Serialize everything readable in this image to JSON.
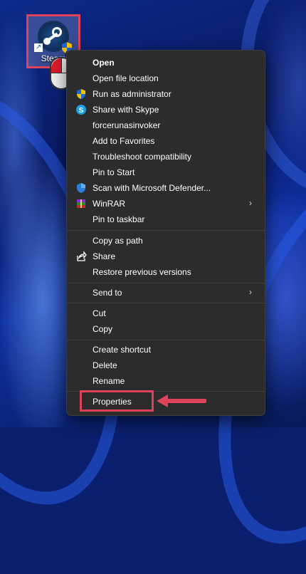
{
  "desktop": {
    "icon_label": "Steam"
  },
  "context_menu": {
    "items": [
      {
        "label": "Open",
        "icon": "none"
      },
      {
        "label": "Open file location",
        "icon": "none"
      },
      {
        "label": "Run as administrator",
        "icon": "uac-shield-icon"
      },
      {
        "label": "Share with Skype",
        "icon": "skype-icon"
      },
      {
        "label": "forcerunasinvoker",
        "icon": "none"
      },
      {
        "label": "Add to Favorites",
        "icon": "none"
      },
      {
        "label": "Troubleshoot compatibility",
        "icon": "none"
      },
      {
        "label": "Pin to Start",
        "icon": "none"
      },
      {
        "label": "Scan with Microsoft Defender...",
        "icon": "defender-shield-icon"
      },
      {
        "label": "WinRAR",
        "icon": "winrar-icon",
        "submenu": true
      },
      {
        "label": "Pin to taskbar",
        "icon": "none"
      },
      {
        "label": "Copy as path",
        "icon": "none"
      },
      {
        "label": "Share",
        "icon": "share-icon"
      },
      {
        "label": "Restore previous versions",
        "icon": "none"
      },
      {
        "label": "Send to",
        "icon": "none",
        "submenu": true
      },
      {
        "label": "Cut",
        "icon": "none"
      },
      {
        "label": "Copy",
        "icon": "none"
      },
      {
        "label": "Create shortcut",
        "icon": "none"
      },
      {
        "label": "Delete",
        "icon": "none"
      },
      {
        "label": "Rename",
        "icon": "none"
      },
      {
        "label": "Properties",
        "icon": "none"
      }
    ],
    "chevron": "›"
  },
  "colors": {
    "highlight_box": "#e0415b",
    "menu_bg": "#2c2c2c",
    "menu_text": "#ffffff"
  }
}
